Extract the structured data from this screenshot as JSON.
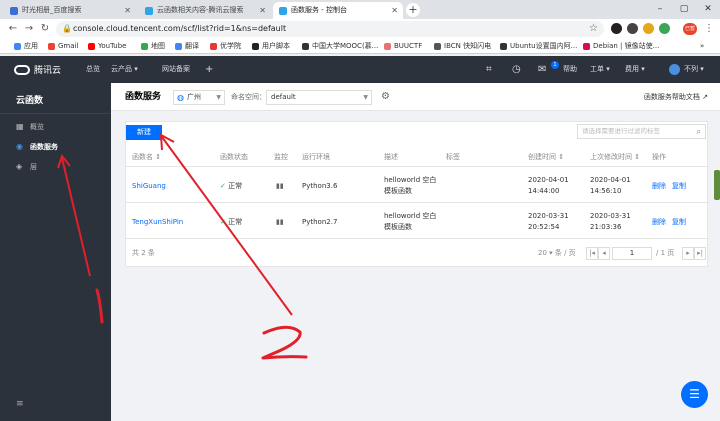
{
  "browser": {
    "tabs": [
      {
        "title": "时光相册_百度搜索",
        "active": false,
        "color": "#3b6ed8"
      },
      {
        "title": "云函数相关内容-腾讯云搜索",
        "active": false,
        "color": "#2ea5e8"
      },
      {
        "title": "函数服务 - 控制台",
        "active": true,
        "color": "#2ea5e8"
      }
    ],
    "url": "console.cloud.tencent.com/scf/list?rid=1&ns=default",
    "bookmarks": [
      {
        "label": "应用",
        "color": "#4285f4"
      },
      {
        "label": "Gmail",
        "color": "#ea4335"
      },
      {
        "label": "YouTube",
        "color": "#ff0000"
      },
      {
        "label": "地图",
        "color": "#34a853"
      },
      {
        "label": "翻译",
        "color": "#4285f4"
      },
      {
        "label": "优学院",
        "color": "#e53935"
      },
      {
        "label": "用户脚本",
        "color": "#222222"
      },
      {
        "label": "中国大学MOOC(慕...",
        "color": "#333333"
      },
      {
        "label": "BUUCTF",
        "color": "#e57373"
      },
      {
        "label": "IBCN 快知闪电",
        "color": "#555555"
      },
      {
        "label": "Ubuntu设置国内阿...",
        "color": "#333333"
      },
      {
        "label": "Debian | 镜像站使...",
        "color": "#d70a53"
      }
    ],
    "profile_label": "已暂停"
  },
  "topnav": {
    "brand": "腾讯云",
    "items": [
      "总览",
      "云产品 ▾",
      "网站备案",
      "+"
    ],
    "right_items": [
      "帮助",
      "工单 ▾",
      "费用 ▾",
      "不列 ▾"
    ],
    "badge": "1"
  },
  "sidebar": {
    "title": "云函数",
    "items": [
      {
        "label": "概览",
        "icon": "grid-icon",
        "active": false
      },
      {
        "label": "函数服务",
        "icon": "function-icon",
        "active": true
      },
      {
        "label": "层",
        "icon": "layers-icon",
        "active": false
      }
    ],
    "footer_icon": "collapse-icon"
  },
  "page": {
    "title": "函数服务",
    "region": "广州",
    "namespace_label": "命名空间：",
    "namespace": "default",
    "help_link": "函数服务帮助文档 ↗",
    "new_button": "新建",
    "search_placeholder": "请选择需要进行过滤的标签",
    "columns": [
      "函数名 ⇕",
      "函数状态",
      "监控",
      "运行环境",
      "描述",
      "标签",
      "创建时间 ⇕",
      "上次修改时间 ⇕",
      "操作"
    ],
    "rows": [
      {
        "name": "ShiGuang",
        "status": "正常",
        "runtime": "Python3.6",
        "desc_1": "helloworld 空白",
        "desc_2": "模板函数",
        "created_1": "2020-04-01",
        "created_2": "14:44:00",
        "modified_1": "2020-04-01",
        "modified_2": "14:56:10",
        "action_delete": "删除",
        "action_copy": "复制"
      },
      {
        "name": "TengXunShiPin",
        "status": "正常",
        "runtime": "Python2.7",
        "desc_1": "helloworld 空白",
        "desc_2": "模板函数",
        "created_1": "2020-03-31",
        "created_2": "20:52:54",
        "modified_1": "2020-03-31",
        "modified_2": "21:03:36",
        "action_delete": "删除",
        "action_copy": "复制"
      }
    ],
    "total": "共 2 条",
    "page_size": "20 ▾ 条 / 页",
    "current_page": "1",
    "total_pages": "/ 1 页"
  },
  "annotations": [
    "1",
    "2"
  ],
  "colors": {
    "accent": "#006eff",
    "nav_bg": "#2c323b",
    "ok": "#0abf5b",
    "ink": "#e0202a"
  }
}
